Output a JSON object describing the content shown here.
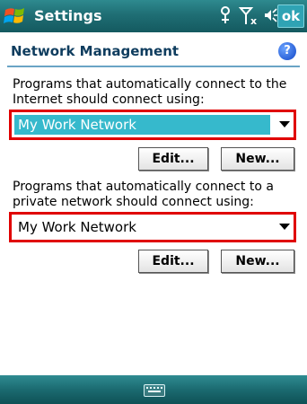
{
  "titlebar": {
    "app_title": "Settings",
    "ok_label": "ok",
    "icons": [
      "windows-start-icon",
      "connectivity-icon",
      "signal-no-connection-icon",
      "volume-icon"
    ]
  },
  "header": {
    "title": "Network Management",
    "help_label": "?"
  },
  "internet": {
    "prompt": "Programs that automatically connect to the Internet should connect using:",
    "selected": "My Work Network",
    "edit_label": "Edit...",
    "new_label": "New..."
  },
  "private": {
    "prompt": "Programs that automatically connect to a private network should connect using:",
    "selected": "My Work Network",
    "edit_label": "Edit...",
    "new_label": "New..."
  },
  "bottombar": {
    "icons": [
      "keyboard-icon"
    ]
  },
  "colors": {
    "titlebar": "#1f6e74",
    "highlight": "#36b9cc",
    "annotation": "#e00000",
    "heading_text": "#0e3c5e"
  }
}
